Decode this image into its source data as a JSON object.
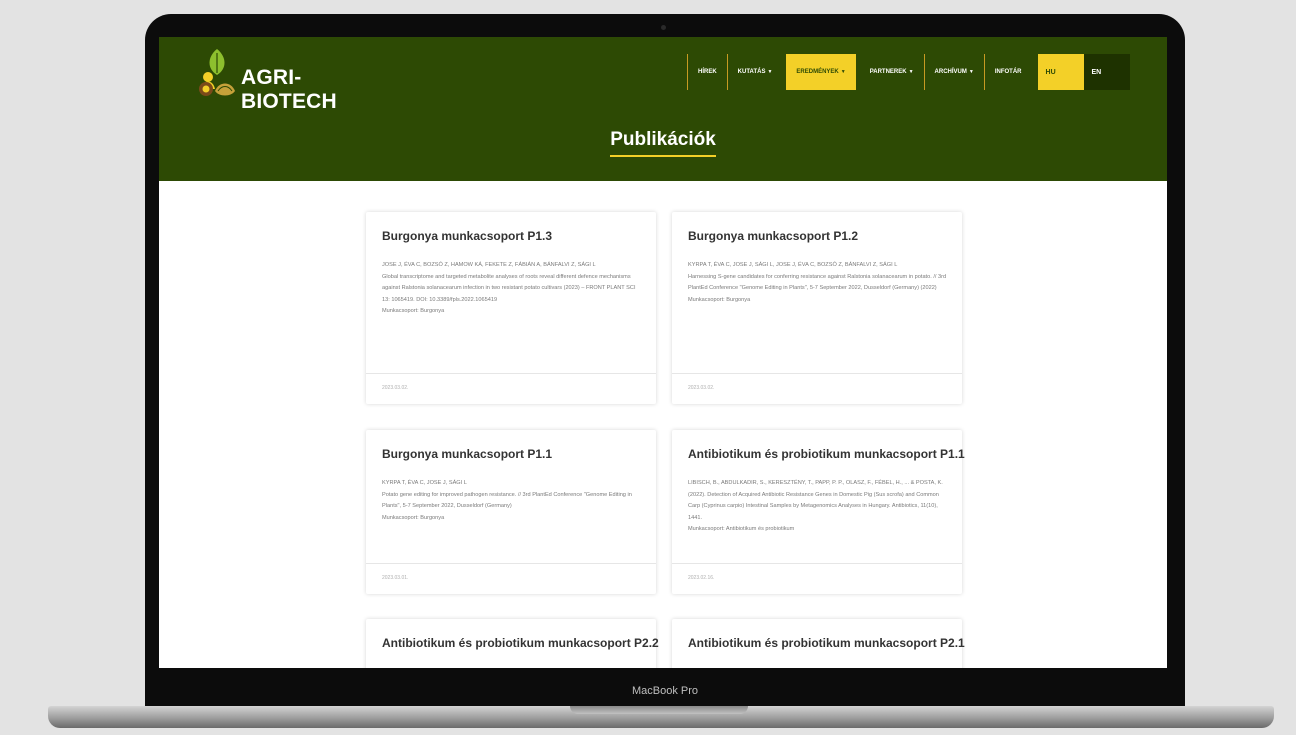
{
  "device_label": "MacBook Pro",
  "site": {
    "name": "AGRI-BIOTECH"
  },
  "nav": {
    "items": [
      {
        "label": "HÍREK",
        "dropdown": false
      },
      {
        "label": "KUTATÁS",
        "dropdown": true
      },
      {
        "label": "EREDMÉNYEK",
        "dropdown": true,
        "active": true
      },
      {
        "label": "PARTNEREK",
        "dropdown": true
      },
      {
        "label": "ARCHÍVUM",
        "dropdown": true
      },
      {
        "label": "INFOTÁR",
        "dropdown": false
      }
    ],
    "languages": [
      "HU",
      "EN"
    ],
    "active_language": "HU"
  },
  "page": {
    "title": "Publikációk"
  },
  "publications": [
    {
      "title": "Burgonya munkacsoport P1.3",
      "authors": "JOSE J, ÉVA C, BOZSÓ Z, HAMOW KÁ, FEKETE Z, FÁBIÁN A, BÁNFALVI Z, SÁGI L",
      "text": "Global transcriptome and targeted metabolite analyses of roots reveal different defence mechanisms against Ralstonia solanacearum infection in two resistant potato cultivars (2023) – FRONT PLANT SCI 13: 1065419. DOI: 10.3389/fpls.2022.1065419",
      "group": "Munkacsoport: Burgonya",
      "date": "2023.03.02."
    },
    {
      "title": "Burgonya munkacsoport P1.2",
      "authors": "KYRPA T, ÉVA C, JOSE J, SÁGI L, JOSE J, ÉVA C, BOZSÓ Z, BÁNFALVI Z, SÁGI L",
      "text": "Harnessing S-gene candidates for conferring resistance against Ralstonia solanacearum in potato. // 3rd PlantEd Conference \"Genome Editing in Plants\", 5-7 September 2022, Dusseldorf (Germany) (2022)",
      "group": "Munkacsoport: Burgonya",
      "date": "2023.03.02."
    },
    {
      "title": "Burgonya munkacsoport P1.1",
      "authors": "KYRPA T, ÉVA C, JOSE J, SÁGI L",
      "text": "Potato gene editing for improved pathogen resistance. // 3rd PlantEd Conference \"Genome Editing in Plants\", 5-7 September 2022, Dusseldorf (Germany)",
      "group": "Munkacsoport: Burgonya",
      "date": "2023.03.01."
    },
    {
      "title": "Antibiotikum és probiotikum munkacsoport P1.1",
      "authors": "",
      "text": "LIBISCH, B., ABDULKADIR, S., KERESZTÉNY, T., PAPP, P. P., OLASZ, F., FÉBEL, H., ... & POSTA, K. (2022). Detection of Acquired Antibiotic Resistance Genes in Domestic Pig (Sus scrofa) and Common Carp (Cyprinus carpio) Intestinal Samples by Metagenomics Analyses in Hungary. Antibiotics, 11(10), 1441.",
      "group": "Munkacsoport: Antibiotikum és probiotikum",
      "date": "2023.02.16."
    },
    {
      "title": "Antibiotikum és probiotikum munkacsoport P2.2",
      "authors": "",
      "text": "",
      "group": "",
      "date": ""
    },
    {
      "title": "Antibiotikum és probiotikum munkacsoport P2.1",
      "authors": "",
      "text": "",
      "group": "",
      "date": ""
    }
  ],
  "colors": {
    "header_green": "#2d4a04",
    "accent_yellow": "#f3d028",
    "bezel": "#0c0c0c"
  }
}
